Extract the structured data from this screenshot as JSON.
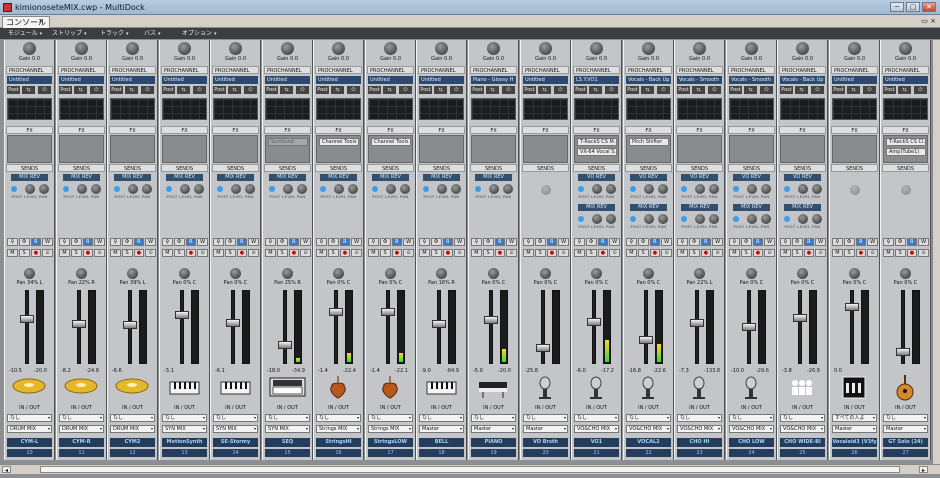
{
  "window": {
    "title": "kimionoseteMIX.cwp - MultiDock",
    "minimize": "─",
    "maximize": "□",
    "close": "✕"
  },
  "tab": {
    "label": "コンソール",
    "close": "×"
  },
  "panel_ctrl": "▭ ×",
  "menu": [
    {
      "label": "モジュール"
    },
    {
      "label": "ストリップ"
    },
    {
      "label": "トラック"
    },
    {
      "label": "バス"
    },
    {
      "label": "オプション"
    }
  ],
  "labels": {
    "gain": "Gain 0.0",
    "prochannel": "PROCHANNEL",
    "post": "Post",
    "fx": "FX",
    "sends": "SENDS",
    "io": "IN / OUT",
    "send_lpl": "POST  LEVEL  PAN",
    "solo": "S",
    "mute": "M",
    "rec": "●",
    "r": "R",
    "w": "W"
  },
  "strips": [
    {
      "num": "10",
      "name": "CYM-L",
      "pan": "Pan 34% L",
      "preset": "Untitled",
      "fx": [],
      "sends": [
        "MIX REV"
      ],
      "in": "なし",
      "out": "DRUM MIX",
      "readout_l": "-10.5",
      "readout_r": "-20.0",
      "icon": "cymbal",
      "fader": 0.62,
      "meter": 0.0
    },
    {
      "num": "11",
      "name": "CYM-R",
      "pan": "Pan 22% R",
      "preset": "Untitled",
      "fx": [],
      "sends": [
        "MIX REV"
      ],
      "in": "なし",
      "out": "DRUM MIX",
      "readout_l": "-8.2",
      "readout_r": "-24.8",
      "icon": "cymbal",
      "fader": 0.55,
      "meter": 0.0
    },
    {
      "num": "12",
      "name": "CYM2",
      "pan": "Pan 39% L",
      "preset": "Untitled",
      "fx": [],
      "sends": [
        "MIX REV"
      ],
      "in": "なし",
      "out": "DRUM MIX",
      "readout_l": "-6.6",
      "readout_r": "",
      "icon": "cymbal",
      "fader": 0.53,
      "meter": 0.0
    },
    {
      "num": "13",
      "name": "MotionSynth",
      "pan": "Pan 0% C",
      "preset": "Untitled",
      "fx": [],
      "sends": [
        "MIX REV"
      ],
      "in": "なし",
      "out": "SYN MIX",
      "readout_l": "-3.1",
      "readout_r": "",
      "icon": "keyboard",
      "fader": 0.68,
      "meter": 0.0
    },
    {
      "num": "14",
      "name": "SE-Stormy",
      "pan": "Pan 0% C",
      "preset": "Untitled",
      "fx": [],
      "sends": [
        "MIX REV"
      ],
      "in": "なし",
      "out": "SYN MIX",
      "readout_l": "-6.1",
      "readout_r": "",
      "icon": "keyboard",
      "fader": 0.56,
      "meter": 0.0
    },
    {
      "num": "15",
      "name": "SEQ",
      "pan": "Pan 25% R",
      "preset": "Untitled",
      "fx": [
        "Surround"
      ],
      "sends": [
        "MIX REV"
      ],
      "in": "なし",
      "out": "SYN MIX",
      "readout_l": "-18.0",
      "readout_r": "-34.9",
      "icon": "synth",
      "fader": 0.22,
      "meter": 0.05
    },
    {
      "num": "16",
      "name": "StringsHI",
      "pan": "Pan 0% C",
      "preset": "Untitled",
      "fx": [
        "Channel Tools"
      ],
      "sends": [
        "MIX REV"
      ],
      "in": "なし",
      "out": "Strings MIX",
      "readout_l": "-1.4",
      "readout_r": "-22.4",
      "icon": "violin",
      "fader": 0.72,
      "meter": 0.12
    },
    {
      "num": "17",
      "name": "StringsLOW",
      "pan": "Pan 0% C",
      "preset": "Untitled",
      "fx": [
        "Channel Tools"
      ],
      "sends": [
        "MIX REV"
      ],
      "in": "なし",
      "out": "Strings MIX",
      "readout_l": "-1.4",
      "readout_r": "-22.1",
      "icon": "violin",
      "fader": 0.72,
      "meter": 0.12
    },
    {
      "num": "18",
      "name": "BELL",
      "pan": "Pan 16% R",
      "preset": "Untitled",
      "fx": [],
      "sends": [
        "MIX REV"
      ],
      "in": "なし",
      "out": "Master",
      "readout_l": "-9.0",
      "readout_r": "-84.9",
      "icon": "keyboard",
      "fader": 0.54,
      "meter": 0.0
    },
    {
      "num": "19",
      "name": "PIANO",
      "pan": "Pan 0% C",
      "preset": "Piano - Glossy H",
      "fx": [],
      "sends": [
        "MIX REV"
      ],
      "in": "なし",
      "out": "Master",
      "readout_l": "-5.0",
      "readout_r": "-20.0",
      "icon": "piano",
      "fader": 0.61,
      "meter": 0.18
    },
    {
      "num": "20",
      "name": "VO Brsth",
      "pan": "Pan 0% C",
      "preset": "Untitled",
      "fx": [],
      "sends": [],
      "in": "なし",
      "out": "Master",
      "readout_l": "-25.8",
      "readout_r": "",
      "icon": "mic",
      "fader": 0.18,
      "meter": 0.0
    },
    {
      "num": "21",
      "name": "VO1",
      "pan": "Pan 0% C",
      "preset": "LS.Y.VO1",
      "fx": [
        "T-RackS CS M...",
        "VX-64 Vocal S..."
      ],
      "sends": [
        "VO REV",
        "MIX REV"
      ],
      "in": "なし",
      "out": "VO&CHO MIX",
      "readout_l": "-6.0",
      "readout_r": "-17.2",
      "icon": "mic",
      "fader": 0.58,
      "meter": 0.3
    },
    {
      "num": "22",
      "name": "VOCAL2",
      "pan": "Pan 0% C",
      "preset": "Vocals - Back Up",
      "fx": [
        "Pitch Shifter"
      ],
      "sends": [
        "VO REV",
        "MIX REV"
      ],
      "in": "なし",
      "out": "VO&CHO MIX",
      "readout_l": "-16.8",
      "readout_r": "-22.6",
      "icon": "mic",
      "fader": 0.3,
      "meter": 0.25
    },
    {
      "num": "23",
      "name": "CHO HI",
      "pan": "Pan 22% L",
      "preset": "Vocals - Smooth",
      "fx": [],
      "sends": [
        "VO REV",
        "MIX REV"
      ],
      "in": "なし",
      "out": "VO&CHO MIX",
      "readout_l": "-7.3",
      "readout_r": "-133.8",
      "icon": "mic",
      "fader": 0.56,
      "meter": 0.0
    },
    {
      "num": "24",
      "name": "CHO LOW",
      "pan": "Pan 0% C",
      "preset": "Vocals - Smooth",
      "fx": [],
      "sends": [
        "VO REV",
        "MIX REV"
      ],
      "in": "なし",
      "out": "VO&CHO MIX",
      "readout_l": "-10.0",
      "readout_r": "-29.6",
      "icon": "mic",
      "fader": 0.5,
      "meter": 0.0
    },
    {
      "num": "25",
      "name": "CHO WIDE-BI",
      "pan": "Pan 0% C",
      "preset": "Vocals - Back Up",
      "fx": [],
      "sends": [
        "VO REV",
        "MIX REV"
      ],
      "in": "なし",
      "out": "VO&CHO MIX",
      "readout_l": "-3.8",
      "readout_r": "-26.8",
      "icon": "group",
      "fader": 0.64,
      "meter": 0.0
    },
    {
      "num": "26",
      "name": "Vocaloid3 (V3fy",
      "pan": "Pan 0% C",
      "preset": "Untitled",
      "fx": [],
      "sends": [],
      "in": "すべての入よ",
      "out": "Master",
      "readout_l": "0.0",
      "readout_r": "",
      "icon": "vocaloid",
      "fader": 0.8,
      "meter": 0.0
    },
    {
      "num": "27",
      "name": "GT Solo (24)",
      "pan": "Pan 0% C",
      "preset": "Untitled",
      "fx": [
        "T-RackS CS Cl...",
        "Amp(Tube1)"
      ],
      "sends": [],
      "in": "なし",
      "out": "Master",
      "readout_l": "",
      "readout_r": "",
      "icon": "guitar",
      "fader": 0.12,
      "meter": 0.0
    }
  ],
  "colors": {
    "strip_bg": "#c4c5c8",
    "name_bg": "#243d5c",
    "send_bg": "#31506f",
    "accent_blue": "#3b79c7"
  }
}
